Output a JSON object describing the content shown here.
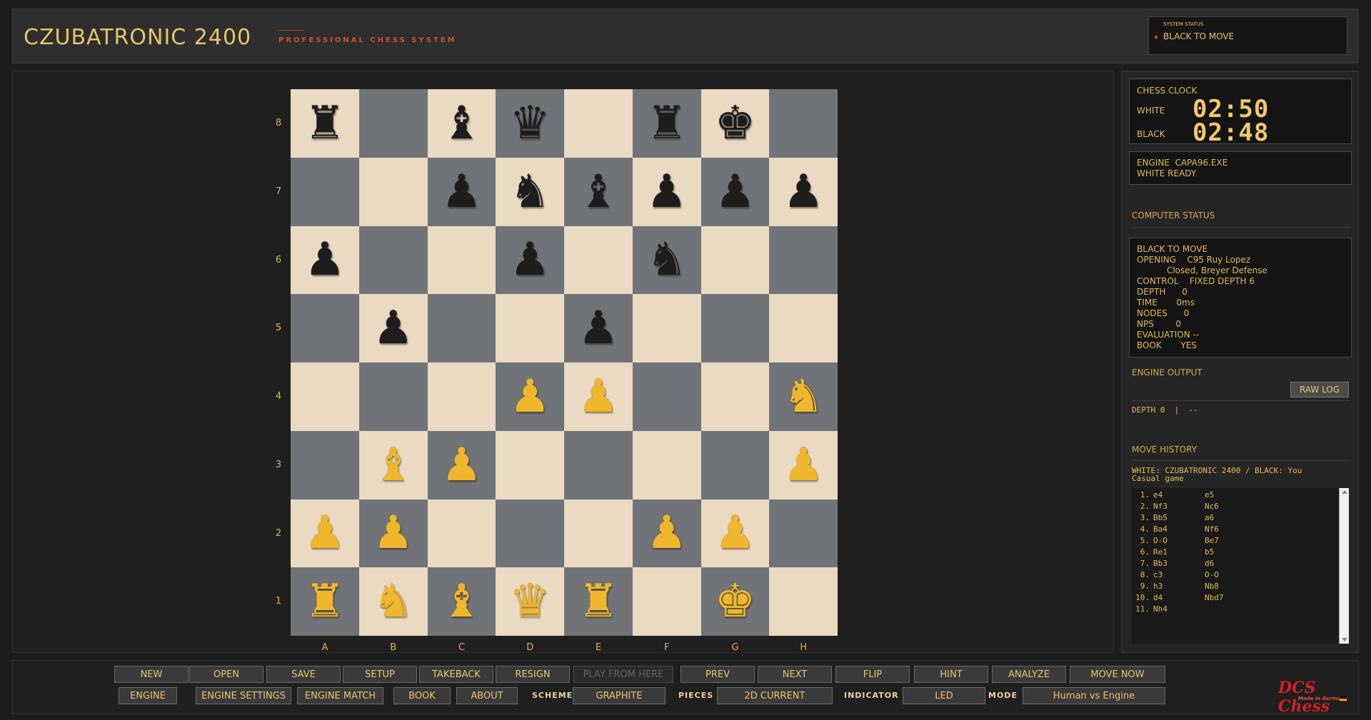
{
  "header": {
    "title": "CZUBATRONIC 2400",
    "subtitle": "PROFESSIONAL CHESS SYSTEM",
    "system_status_label": "SYSTEM STATUS",
    "system_status": "BLACK TO MOVE"
  },
  "board": {
    "ranks": [
      "8",
      "7",
      "6",
      "5",
      "4",
      "3",
      "2",
      "1"
    ],
    "files": [
      "A",
      "B",
      "C",
      "D",
      "E",
      "F",
      "G",
      "H"
    ],
    "rows": [
      [
        {
          "p": "♜",
          "c": "black",
          "n": "black-rook"
        },
        {
          "p": "",
          "c": "",
          "n": ""
        },
        {
          "p": "♝",
          "c": "black",
          "n": "black-bishop"
        },
        {
          "p": "♛",
          "c": "black",
          "n": "black-queen"
        },
        {
          "p": "",
          "c": "",
          "n": ""
        },
        {
          "p": "♜",
          "c": "black",
          "n": "black-rook"
        },
        {
          "p": "♚",
          "c": "black",
          "n": "black-king"
        },
        {
          "p": "",
          "c": "",
          "n": ""
        }
      ],
      [
        {
          "p": "",
          "c": "",
          "n": ""
        },
        {
          "p": "",
          "c": "",
          "n": ""
        },
        {
          "p": "♟",
          "c": "black",
          "n": "black-pawn"
        },
        {
          "p": "♞",
          "c": "black",
          "n": "black-knight"
        },
        {
          "p": "♝",
          "c": "black",
          "n": "black-bishop"
        },
        {
          "p": "♟",
          "c": "black",
          "n": "black-pawn"
        },
        {
          "p": "♟",
          "c": "black",
          "n": "black-pawn"
        },
        {
          "p": "♟",
          "c": "black",
          "n": "black-pawn"
        }
      ],
      [
        {
          "p": "♟",
          "c": "black",
          "n": "black-pawn"
        },
        {
          "p": "",
          "c": "",
          "n": ""
        },
        {
          "p": "",
          "c": "",
          "n": ""
        },
        {
          "p": "♟",
          "c": "black",
          "n": "black-pawn"
        },
        {
          "p": "",
          "c": "",
          "n": ""
        },
        {
          "p": "♞",
          "c": "black",
          "n": "black-knight"
        },
        {
          "p": "",
          "c": "",
          "n": ""
        },
        {
          "p": "",
          "c": "",
          "n": ""
        }
      ],
      [
        {
          "p": "",
          "c": "",
          "n": ""
        },
        {
          "p": "♟",
          "c": "black",
          "n": "black-pawn"
        },
        {
          "p": "",
          "c": "",
          "n": ""
        },
        {
          "p": "",
          "c": "",
          "n": ""
        },
        {
          "p": "♟",
          "c": "black",
          "n": "black-pawn"
        },
        {
          "p": "",
          "c": "",
          "n": ""
        },
        {
          "p": "",
          "c": "",
          "n": ""
        },
        {
          "p": "",
          "c": "",
          "n": ""
        }
      ],
      [
        {
          "p": "",
          "c": "",
          "n": ""
        },
        {
          "p": "",
          "c": "",
          "n": ""
        },
        {
          "p": "",
          "c": "",
          "n": ""
        },
        {
          "p": "♟",
          "c": "white",
          "n": "white-pawn"
        },
        {
          "p": "♟",
          "c": "white",
          "n": "white-pawn"
        },
        {
          "p": "",
          "c": "",
          "n": ""
        },
        {
          "p": "",
          "c": "",
          "n": ""
        },
        {
          "p": "♞",
          "c": "white",
          "n": "white-knight"
        }
      ],
      [
        {
          "p": "",
          "c": "",
          "n": ""
        },
        {
          "p": "♝",
          "c": "white",
          "n": "white-bishop"
        },
        {
          "p": "♟",
          "c": "white",
          "n": "white-pawn"
        },
        {
          "p": "",
          "c": "",
          "n": ""
        },
        {
          "p": "",
          "c": "",
          "n": ""
        },
        {
          "p": "",
          "c": "",
          "n": ""
        },
        {
          "p": "",
          "c": "",
          "n": ""
        },
        {
          "p": "♟",
          "c": "white",
          "n": "white-pawn"
        }
      ],
      [
        {
          "p": "♟",
          "c": "white",
          "n": "white-pawn"
        },
        {
          "p": "♟",
          "c": "white",
          "n": "white-pawn"
        },
        {
          "p": "",
          "c": "",
          "n": ""
        },
        {
          "p": "",
          "c": "",
          "n": ""
        },
        {
          "p": "",
          "c": "",
          "n": ""
        },
        {
          "p": "♟",
          "c": "white",
          "n": "white-pawn"
        },
        {
          "p": "♟",
          "c": "white",
          "n": "white-pawn"
        },
        {
          "p": "",
          "c": "",
          "n": ""
        }
      ],
      [
        {
          "p": "♜",
          "c": "white",
          "n": "white-rook"
        },
        {
          "p": "♞",
          "c": "white",
          "n": "white-knight"
        },
        {
          "p": "♝",
          "c": "white",
          "n": "white-bishop"
        },
        {
          "p": "♛",
          "c": "white",
          "n": "white-queen"
        },
        {
          "p": "♜",
          "c": "white",
          "n": "white-rook"
        },
        {
          "p": "",
          "c": "",
          "n": ""
        },
        {
          "p": "♚",
          "c": "white",
          "n": "white-king"
        },
        {
          "p": "",
          "c": "",
          "n": ""
        }
      ]
    ]
  },
  "clock": {
    "title": "CHESS CLOCK",
    "white_label": "WHITE",
    "white_time": "02:50",
    "black_label": "BLACK",
    "black_time": "02:48"
  },
  "engine": {
    "line1": "ENGINE  CAPA96.EXE",
    "line2": "WHITE READY"
  },
  "computer_status": {
    "title": "COMPUTER STATUS",
    "lines": [
      "BLACK TO MOVE",
      "OPENING    C95 Ruy Lopez",
      "           Closed, Breyer Defense",
      "CONTROL    FIXED DEPTH 6",
      "DEPTH      0",
      "TIME       0ms",
      "NODES      0",
      "NPS        0",
      "EVALUATION --",
      "BOOK       YES"
    ]
  },
  "engine_output": {
    "title": "ENGINE OUTPUT",
    "raw_log_label": "RAW LOG",
    "text": "DEPTH 0  |  --"
  },
  "move_history": {
    "title": "MOVE HISTORY",
    "players": "WHITE: CZUBATRONIC 2400  /  BLACK: You",
    "game_type": "Casual game",
    "moves": [
      {
        "n": "1.",
        "w": "e4",
        "b": "e5"
      },
      {
        "n": "2.",
        "w": "Nf3",
        "b": "Nc6"
      },
      {
        "n": "3.",
        "w": "Bb5",
        "b": "a6"
      },
      {
        "n": "4.",
        "w": "Ba4",
        "b": "Nf6"
      },
      {
        "n": "5.",
        "w": "O-O",
        "b": "Be7"
      },
      {
        "n": "6.",
        "w": "Re1",
        "b": "b5"
      },
      {
        "n": "7.",
        "w": "Bb3",
        "b": "d6"
      },
      {
        "n": "8.",
        "w": "c3",
        "b": "O-O"
      },
      {
        "n": "9.",
        "w": "h3",
        "b": "Nb8"
      },
      {
        "n": "10.",
        "w": "d4",
        "b": "Nbd7"
      },
      {
        "n": "11.",
        "w": "Nh4",
        "b": ""
      }
    ]
  },
  "toolbar": {
    "row1": [
      {
        "label": "NEW",
        "name": "new-button",
        "disabled": false
      },
      {
        "label": "OPEN",
        "name": "open-button",
        "disabled": false
      },
      {
        "label": "SAVE",
        "name": "save-button",
        "disabled": false
      },
      {
        "label": "SETUP",
        "name": "setup-button",
        "disabled": false
      },
      {
        "label": "TAKEBACK",
        "name": "takeback-button",
        "disabled": false
      },
      {
        "label": "RESIGN",
        "name": "resign-button",
        "disabled": false
      },
      {
        "label": "PLAY FROM HERE",
        "name": "play-from-here-button",
        "disabled": true
      },
      {
        "label": "PREV",
        "name": "prev-button",
        "disabled": false
      },
      {
        "label": "NEXT",
        "name": "next-button",
        "disabled": false
      },
      {
        "label": "FLIP",
        "name": "flip-button",
        "disabled": false
      },
      {
        "label": "HINT",
        "name": "hint-button",
        "disabled": false
      },
      {
        "label": "ANALYZE",
        "name": "analyze-button",
        "disabled": false
      },
      {
        "label": "MOVE NOW",
        "name": "move-now-button",
        "disabled": false
      }
    ],
    "engine_label": "ENGINE",
    "engine_settings_label": "ENGINE SETTINGS",
    "engine_match_label": "ENGINE MATCH",
    "book_label": "BOOK",
    "about_label": "ABOUT",
    "scheme_label": "SCHEME",
    "scheme_value": "GRAPHITE",
    "pieces_label": "PIECES",
    "pieces_value": "2D CURRENT",
    "indicator_label": "INDICATOR",
    "indicator_value": "LED",
    "mode_label": "MODE",
    "mode_value": "Human vs Engine"
  },
  "brand": {
    "name": "DCS Chess",
    "tagline": "Made in Germany"
  },
  "colors": {
    "accent": "#e8c46a",
    "light_square": "#eadac2",
    "dark_square": "#707378",
    "brand_red": "#d51f1f"
  }
}
